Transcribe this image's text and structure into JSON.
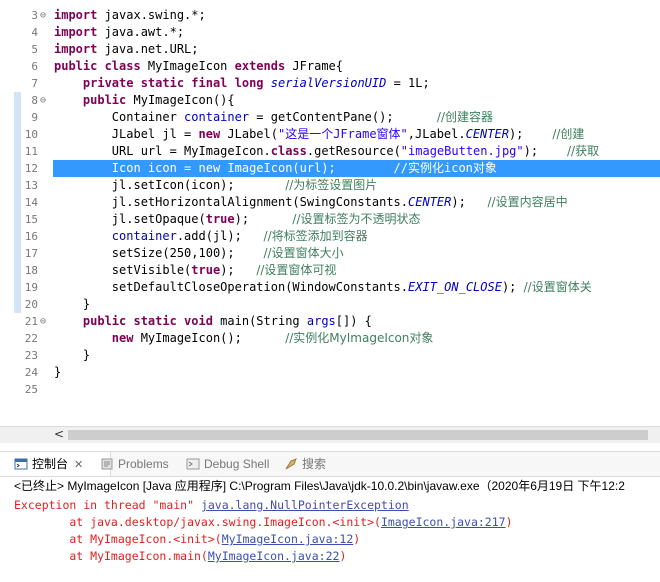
{
  "editor": {
    "lines": [
      {
        "n": "3",
        "fold": "⊖",
        "tokens": [
          {
            "t": "import",
            "c": "kw"
          },
          {
            "t": " javax.swing.*;"
          }
        ]
      },
      {
        "n": "4",
        "tokens": [
          {
            "t": "import",
            "c": "kw"
          },
          {
            "t": " java.awt.*;"
          }
        ]
      },
      {
        "n": "5",
        "tokens": [
          {
            "t": "import",
            "c": "kw"
          },
          {
            "t": " java.net.URL;"
          }
        ]
      },
      {
        "n": "6",
        "tokens": [
          {
            "t": "public class",
            "c": "kw"
          },
          {
            "t": " MyImageIcon "
          },
          {
            "t": "extends",
            "c": "kw"
          },
          {
            "t": " JFrame{"
          }
        ]
      },
      {
        "n": "7",
        "tokens": [
          {
            "t": "    "
          },
          {
            "t": "private static final long",
            "c": "kw"
          },
          {
            "t": " "
          },
          {
            "t": "serialVersionUID",
            "c": "sfld"
          },
          {
            "t": " = 1L;"
          }
        ]
      },
      {
        "n": "8",
        "fold": "⊖",
        "mark": true,
        "tokens": [
          {
            "t": "    "
          },
          {
            "t": "public",
            "c": "kw"
          },
          {
            "t": " MyImageIcon(){"
          }
        ]
      },
      {
        "n": "9",
        "mark": true,
        "tokens": [
          {
            "t": "        Container "
          },
          {
            "t": "container",
            "c": "fld"
          },
          {
            "t": " = getContentPane();      "
          },
          {
            "t": "//创建容器",
            "c": "cm"
          }
        ]
      },
      {
        "n": "10",
        "mark": true,
        "tokens": [
          {
            "t": "        JLabel jl = "
          },
          {
            "t": "new",
            "c": "kw"
          },
          {
            "t": " JLabel("
          },
          {
            "t": "\"这是一个JFrame窗体\"",
            "c": "str"
          },
          {
            "t": ",JLabel."
          },
          {
            "t": "CENTER",
            "c": "sfld"
          },
          {
            "t": ");    "
          },
          {
            "t": "//创建",
            "c": "cm"
          }
        ]
      },
      {
        "n": "11",
        "mark": true,
        "tokens": [
          {
            "t": "        URL url = MyImageIcon."
          },
          {
            "t": "class",
            "c": "kw"
          },
          {
            "t": ".getResource("
          },
          {
            "t": "\"imageButten.jpg\"",
            "c": "str"
          },
          {
            "t": ");    "
          },
          {
            "t": "//获取",
            "c": "cm"
          }
        ]
      },
      {
        "n": "12",
        "mark": true,
        "sel": true,
        "tokens": [
          {
            "t": "        Icon icon = new ImageIcon(url);        //实例化icon对象"
          }
        ]
      },
      {
        "n": "13",
        "mark": true,
        "tokens": [
          {
            "t": "        jl.setIcon(icon);       "
          },
          {
            "t": "//为标签设置图片",
            "c": "cm"
          }
        ]
      },
      {
        "n": "14",
        "mark": true,
        "tokens": [
          {
            "t": "        jl.setHorizontalAlignment(SwingConstants."
          },
          {
            "t": "CENTER",
            "c": "sfld"
          },
          {
            "t": ");   "
          },
          {
            "t": "//设置内容居中",
            "c": "cm"
          }
        ]
      },
      {
        "n": "15",
        "mark": true,
        "tokens": [
          {
            "t": "        jl.setOpaque("
          },
          {
            "t": "true",
            "c": "kw"
          },
          {
            "t": ");      "
          },
          {
            "t": "//设置标签为不透明状态",
            "c": "cm"
          }
        ]
      },
      {
        "n": "16",
        "mark": true,
        "tokens": [
          {
            "t": "        "
          },
          {
            "t": "container",
            "c": "fld"
          },
          {
            "t": ".add(jl);   "
          },
          {
            "t": "//将标签添加到容器",
            "c": "cm"
          }
        ]
      },
      {
        "n": "17",
        "mark": true,
        "tokens": [
          {
            "t": "        setSize(250,100);    "
          },
          {
            "t": "//设置窗体大小",
            "c": "cm"
          }
        ]
      },
      {
        "n": "18",
        "mark": true,
        "tokens": [
          {
            "t": "        setVisible("
          },
          {
            "t": "true",
            "c": "kw"
          },
          {
            "t": ");   "
          },
          {
            "t": "//设置窗体可视",
            "c": "cm"
          }
        ]
      },
      {
        "n": "19",
        "mark": true,
        "tokens": [
          {
            "t": "        setDefaultCloseOperation(WindowConstants."
          },
          {
            "t": "EXIT_ON_CLOSE",
            "c": "sfld"
          },
          {
            "t": "); "
          },
          {
            "t": "//设置窗体关",
            "c": "cm"
          }
        ]
      },
      {
        "n": "20",
        "mark": true,
        "tokens": [
          {
            "t": "    }"
          }
        ]
      },
      {
        "n": "21",
        "fold": "⊖",
        "tokens": [
          {
            "t": "    "
          },
          {
            "t": "public static void",
            "c": "kw"
          },
          {
            "t": " main(String "
          },
          {
            "t": "args",
            "c": "fld"
          },
          {
            "t": "[]) {"
          }
        ]
      },
      {
        "n": "22",
        "tokens": [
          {
            "t": "        "
          },
          {
            "t": "new",
            "c": "kw"
          },
          {
            "t": " MyImageIcon();      "
          },
          {
            "t": "//实例化MyImageIcon对象",
            "c": "cm"
          }
        ]
      },
      {
        "n": "23",
        "tokens": [
          {
            "t": "    }"
          }
        ]
      },
      {
        "n": "24",
        "tokens": [
          {
            "t": "}"
          }
        ]
      },
      {
        "n": "25",
        "tokens": []
      }
    ]
  },
  "tabs": [
    {
      "label": "控制台",
      "icon": "console-icon",
      "active": true,
      "close": "✕"
    },
    {
      "label": "Problems",
      "icon": "problems-icon"
    },
    {
      "label": "Debug Shell",
      "icon": "debug-shell-icon"
    },
    {
      "label": "搜索",
      "icon": "search-icon"
    }
  ],
  "console": {
    "header": "<已终止> MyImageIcon [Java 应用程序] C:\\Program Files\\Java\\jdk-10.0.2\\bin\\javaw.exe（2020年6月19日 下午12:2",
    "lines": [
      {
        "text": "Exception in thread \"main\" ",
        "link": "java.lang.NullPointerException",
        "tail": ""
      },
      {
        "text": "        at java.desktop/javax.swing.ImageIcon.<init>(",
        "link": "ImageIcon.java:217",
        "tail": ")"
      },
      {
        "text": "        at MyImageIcon.<init>(",
        "link": "MyImageIcon.java:12",
        "tail": ")"
      },
      {
        "text": "        at MyImageIcon.main(",
        "link": "MyImageIcon.java:22",
        "tail": ")"
      }
    ]
  },
  "scrollbar": {
    "left_arrow": "<"
  }
}
